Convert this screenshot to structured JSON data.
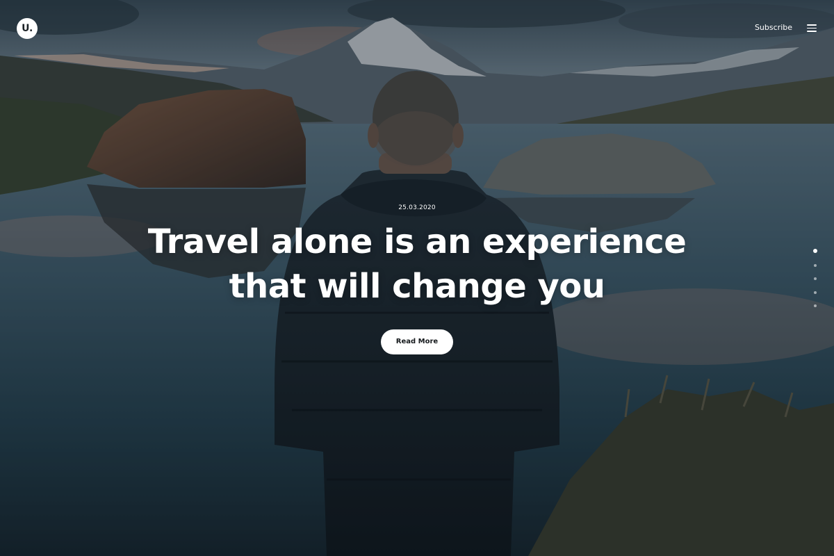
{
  "header": {
    "logo_text": "U.",
    "subscribe_label": "Subscribe",
    "menu_icon": "hamburger-menu-icon"
  },
  "hero": {
    "date": "25.03.2020",
    "title": "Travel alone is an experience that will change you",
    "button_label": "Read More"
  },
  "slider": {
    "slide_count": 5,
    "active_index": 0
  },
  "colors": {
    "text": "#ffffff",
    "button_bg": "#ffffff",
    "button_text": "#15191c"
  }
}
